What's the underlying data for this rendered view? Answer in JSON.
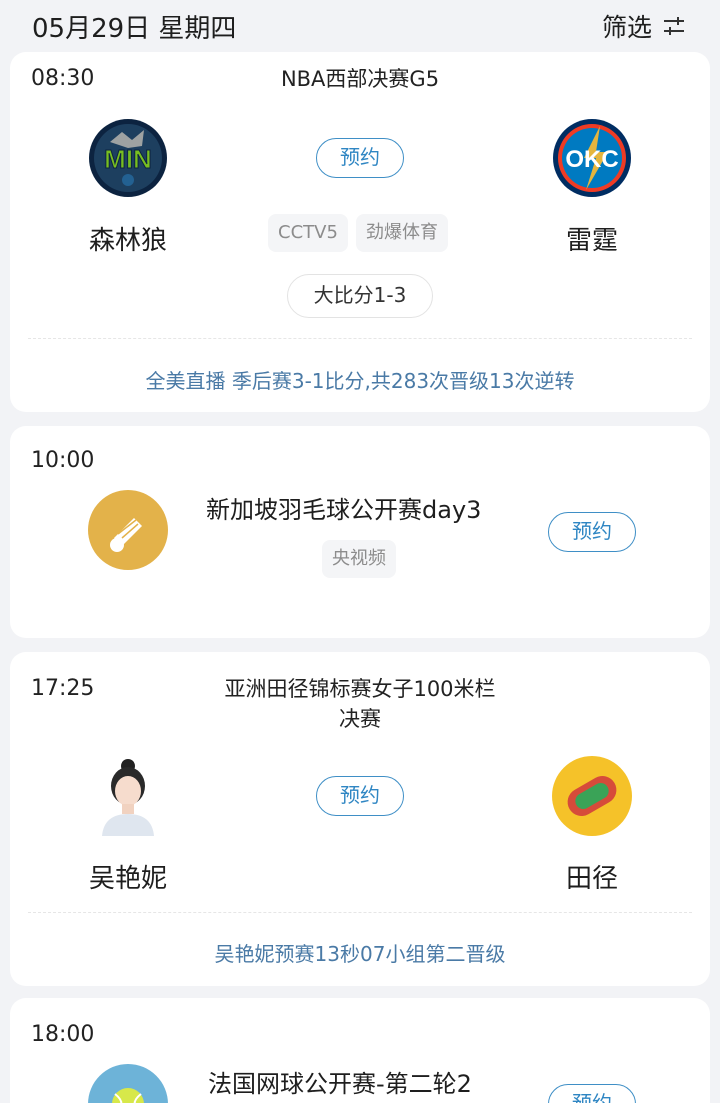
{
  "header": {
    "date": "05月29日 星期四",
    "filter_label": "筛选"
  },
  "matches": [
    {
      "time": "08:30",
      "title": "NBA西部决赛G5",
      "home": {
        "name": "森林狼",
        "logo_text": "MIN"
      },
      "away": {
        "name": "雷霆",
        "logo_text": "OKC"
      },
      "reserve_label": "预约",
      "channels": [
        "CCTV5",
        "劲爆体育"
      ],
      "series_score": "大比分1-3",
      "note": "全美直播 季后赛3-1比分,共283次晋级13次逆转"
    },
    {
      "time": "10:00",
      "title": "新加坡羽毛球公开赛day3",
      "channels": [
        "央视频"
      ],
      "reserve_label": "预约",
      "icon": "badminton-icon"
    },
    {
      "time": "17:25",
      "title_line1": "亚洲田径锦标赛女子100米栏",
      "title_line2": "决赛",
      "home": {
        "name": "吴艳妮"
      },
      "away": {
        "name": "田径"
      },
      "reserve_label": "预约",
      "note": "吴艳妮预赛13秒07小组第二晋级"
    },
    {
      "time": "18:00",
      "title": "法国网球公开赛-第二轮2",
      "reserve_label": "预约",
      "icon": "tennis-icon"
    }
  ],
  "colors": {
    "accent": "#2f86c3",
    "note": "#4a7aa6",
    "background": "#f2f3f6"
  }
}
